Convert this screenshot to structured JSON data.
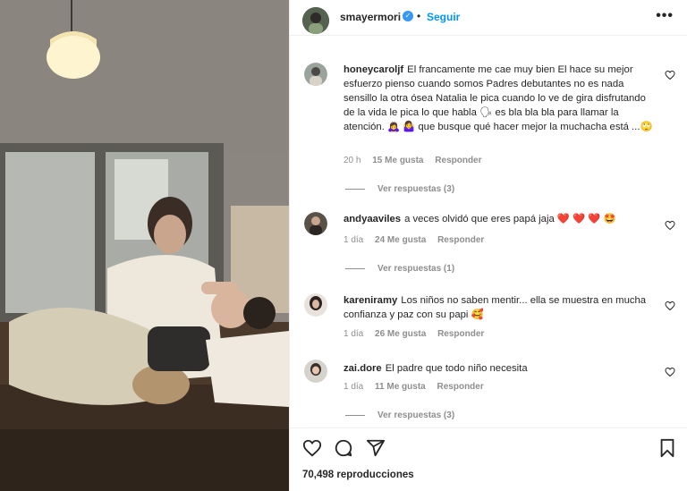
{
  "header": {
    "username": "smayermori",
    "verified_glyph": "✓",
    "separator": "•",
    "follow_label": "Seguir",
    "more_label": "•••"
  },
  "comments": [
    {
      "username": "honeycaroljf",
      "text": "El francamente me cae muy bien El hace su mejor esfuerzo pienso cuando somos Padres debutantes no es nada sensillo la otra ósea Natalia le pica cuando lo ve de gira disfrutando de la vida le pica lo que habla 🗣 es bla bla bla para llamar la atención. 🙇‍♀️ 🤷‍♀️ que busque qué hacer mejor la muchacha está ...🙄",
      "time": "20 h",
      "likes": "15 Me gusta",
      "reply_label": "Responder",
      "replies": "Ver respuestas (3)"
    },
    {
      "username": "andyaaviles",
      "text": "a veces olvidó que eres papá jaja ❤️ ❤️ ❤️ 🤩",
      "time": "1 día",
      "likes": "24 Me gusta",
      "reply_label": "Responder",
      "replies": "Ver respuestas (1)"
    },
    {
      "username": "kareniramy",
      "text": "Los niños no saben mentir... ella se muestra en mucha confianza y paz con su papi 🥰",
      "time": "1 día",
      "likes": "26 Me gusta",
      "reply_label": "Responder",
      "replies": ""
    },
    {
      "username": "zai.dore",
      "text": "El padre que todo niño necesita",
      "time": "1 día",
      "likes": "11 Me gusta",
      "reply_label": "Responder",
      "replies": "Ver respuestas (3)"
    }
  ],
  "actions": {
    "views": "70,498 reproducciones"
  },
  "icons": {
    "like": "heart-icon",
    "comment": "comment-icon",
    "share": "share-icon",
    "save": "bookmark-icon"
  }
}
